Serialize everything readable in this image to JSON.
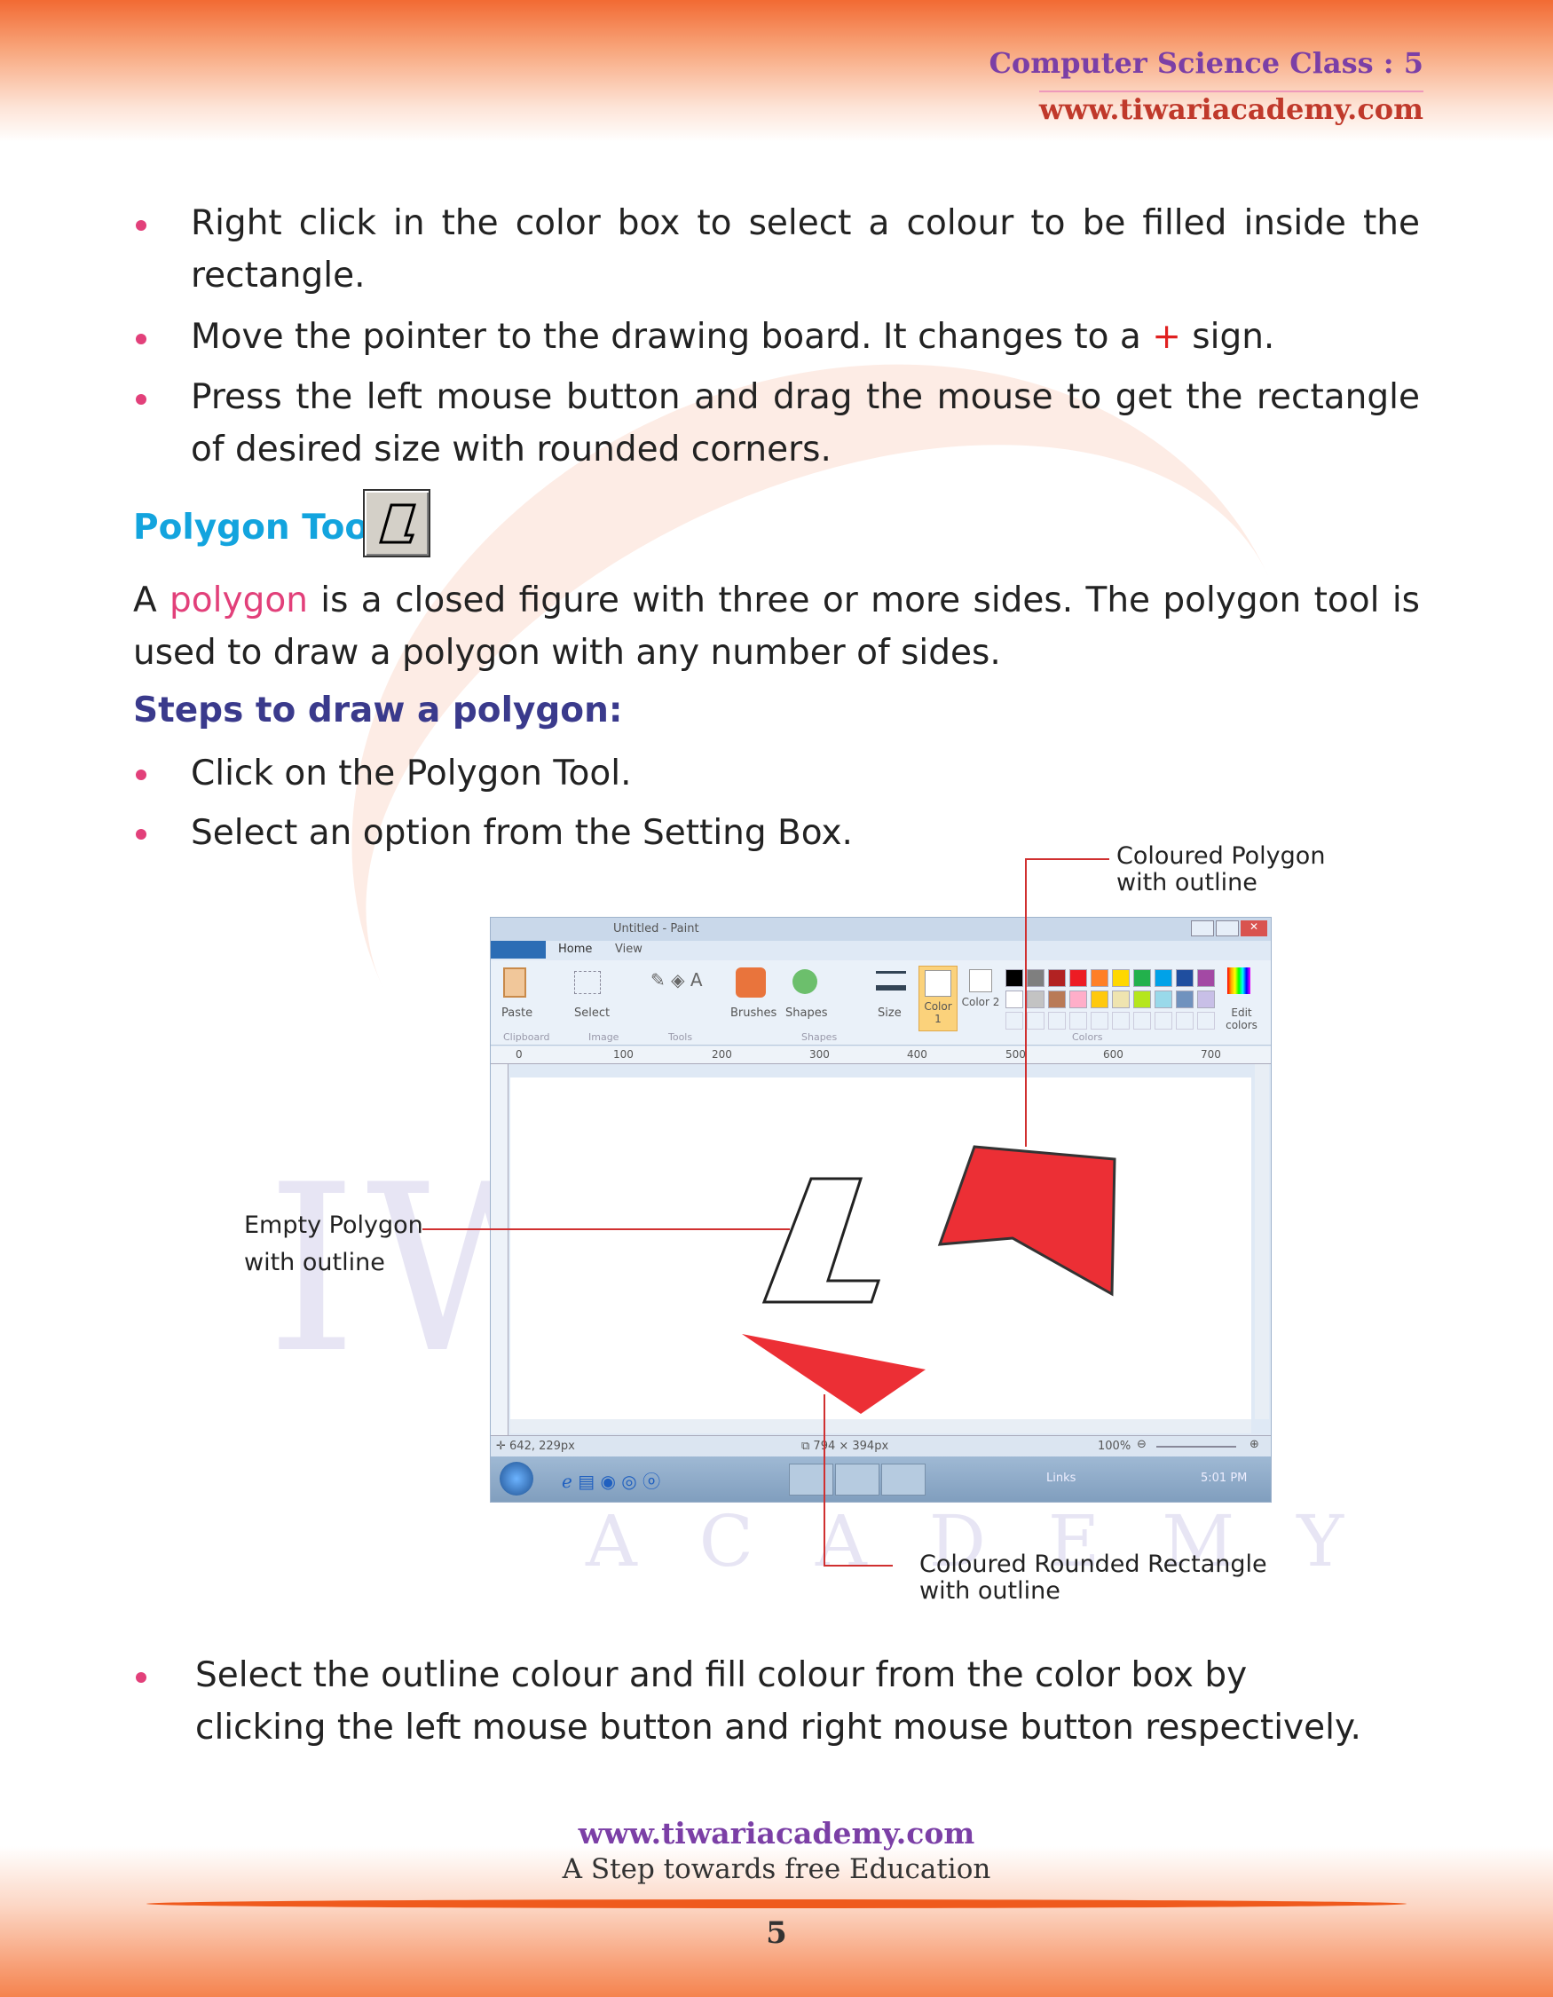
{
  "header": {
    "class": "Computer Science Class : 5",
    "website": "www.tiwariacademy.com"
  },
  "bullets_top": [
    "Right click in the color box to select a colour to be filled inside the rectangle.",
    {
      "before": "Move the pointer to the drawing board. It changes to a ",
      "sign": "+",
      "after": " sign."
    },
    "Press the left mouse button and drag the mouse to get the rectangle of desired size with rounded corners."
  ],
  "polygon_heading": "Polygon Tool",
  "polygon_icon": "polygon-tool-icon",
  "definition": {
    "a": "A ",
    "term": "polygon",
    "rest": " is a closed figure with three or more sides. The polygon tool is used to draw a polygon with any number of sides."
  },
  "steps_heading": "Steps to draw a polygon:",
  "steps": [
    "Click on the Polygon Tool.",
    "Select an option from the Setting Box."
  ],
  "figure": {
    "callouts": {
      "coloured_polygon": [
        "Coloured Polygon",
        "with outline"
      ],
      "empty_polygon": [
        "Empty Polygon",
        "with outline"
      ],
      "rounded_rect": [
        "Coloured Rounded Rectangle",
        "with outline"
      ]
    },
    "paint": {
      "title": "Untitled - Paint",
      "tabs": [
        "Home",
        "View"
      ],
      "groups": [
        "Clipboard",
        "Image",
        "Tools",
        "Shapes",
        "Colors"
      ],
      "buttons": [
        "Paste",
        "Select",
        "Brushes",
        "Shapes",
        "Size",
        "Color 1",
        "Color 2",
        "Edit colors"
      ],
      "ruler": [
        "0",
        "100",
        "200",
        "300",
        "400",
        "500",
        "600",
        "700"
      ],
      "status": {
        "cursor": "642, 229px",
        "size": "794 × 394px",
        "zoom": "100%"
      },
      "taskbar": {
        "links": "Links",
        "time": "5:01 PM"
      },
      "palette": [
        "#000000",
        "#7f7f7f",
        "#b22222",
        "#ed1c24",
        "#ff7f27",
        "#ffd800",
        "#22b14c",
        "#00a2e8",
        "#1f4e9f",
        "#a349a4",
        "#ffffff",
        "#c3c3c3",
        "#b97a57",
        "#ffaec9",
        "#ffc90e",
        "#efe4b0",
        "#b5e61d",
        "#99d9ea",
        "#7092be",
        "#c8bfe7"
      ],
      "shape_color": "#ec2f35"
    }
  },
  "bullet_bottom": "Select the outline colour and fill colour from the color box by clicking the left mouse button and right mouse button respectively.",
  "footer": {
    "website": "www.tiwariacademy.com",
    "tagline": "A Step towards free Education",
    "page": "5"
  }
}
